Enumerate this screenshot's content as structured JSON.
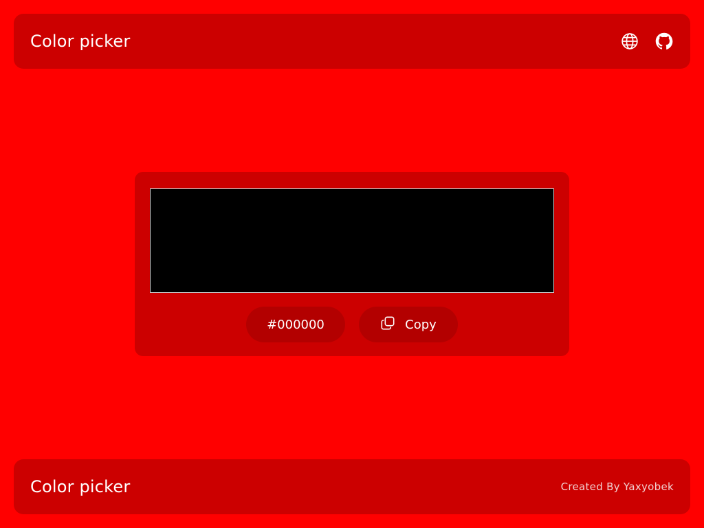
{
  "header": {
    "title": "Color picker",
    "icons": [
      "globe-icon",
      "github-icon"
    ]
  },
  "picker": {
    "color": "#000000",
    "hex_value": "#000000",
    "copy_label": "Copy",
    "copy_icon": "copy-icon"
  },
  "footer": {
    "title": "Color picker",
    "credit": "Created By Yaxyobek"
  },
  "theme": {
    "background": "#ff0000",
    "panel": "#cc0000",
    "pill": "#b30000"
  }
}
